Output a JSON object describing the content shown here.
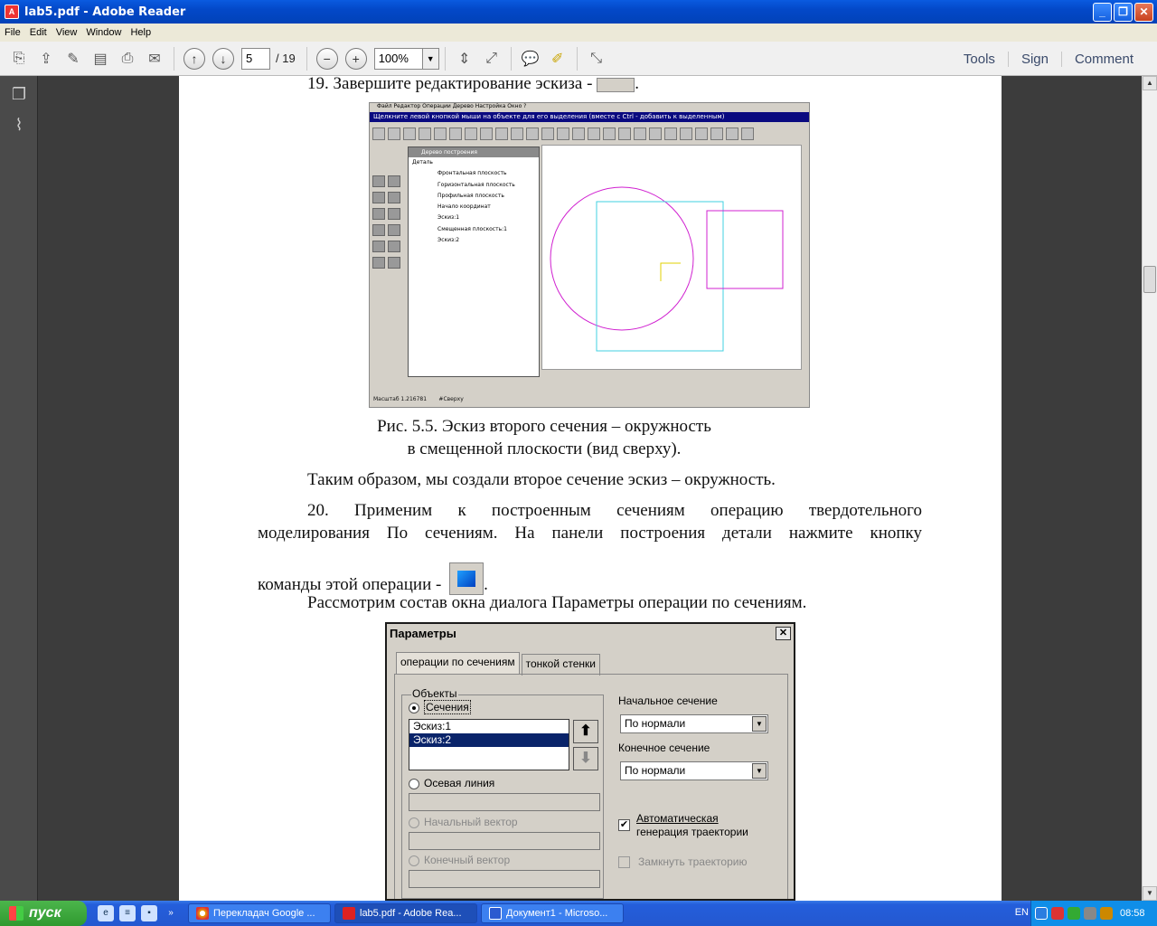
{
  "window": {
    "title": "lab5.pdf - Adobe Reader"
  },
  "menu": [
    "File",
    "Edit",
    "View",
    "Window",
    "Help"
  ],
  "toolbar": {
    "page_current": "5",
    "page_total": "/ 19",
    "zoom": "100%",
    "right_buttons": [
      "Tools",
      "Sign",
      "Comment"
    ]
  },
  "document": {
    "step19": "19. Завершите редактирование эскиза -",
    "step19_end": ".",
    "caption_line1": "Рис. 5.5. Эскиз второго сечения – окружность",
    "caption_line2": "в смещенной плоскости (вид сверху).",
    "para1": "Таким образом, мы создали второе сечение эскиз – окружность.",
    "step20_line1": "20. Применим к построенным сечениям операцию твердотельного",
    "step20_line2": "моделирования По сечениям. На панели построения детали нажмите кнопку",
    "step20_line3": "команды этой операции -",
    "step20_end": ".",
    "para2": "Рассмотрим состав окна диалога Параметры операции по сечениям."
  },
  "cad": {
    "menu": "Файл  Редактор  Операции  Дерево  Настройка  Окно  ?",
    "hint": "Щелкните левой кнопкой мыши на объекте для его выделения (вместе с Ctrl - добавить к выделенным)",
    "tree_title": "Дерево построения",
    "tree_items": [
      "Деталь",
      "Фронтальная плоскость",
      "Горизонтальная плоскость",
      "Профильная плоскость",
      "Начало координат",
      "Эскиз:1",
      "Смещенная плоскость:1",
      "Эскиз:2"
    ],
    "status_scale": "Масштаб 1.216781",
    "status_view": "#Сверху"
  },
  "dialog": {
    "title": "Параметры",
    "tabs": [
      "операции по сечениям",
      "тонкой стенки"
    ],
    "group_label": "Объекты",
    "radio_sections": "Сечения",
    "sections": [
      "Эскиз:1",
      "Эскиз:2"
    ],
    "radio_axis": "Осевая линия",
    "radio_start_vector": "Начальный вектор",
    "radio_end_vector": "Конечный вектор",
    "start_section_label": "Начальное сечение",
    "start_section_value": "По нормали",
    "end_section_label": "Конечное сечение",
    "end_section_value": "По нормали",
    "auto_traj": "Автоматическая",
    "auto_traj2": "генерация траектории",
    "close_traj": "Замкнуть траекторию"
  },
  "taskbar": {
    "start": "пуск",
    "tasks": [
      "Перекладач Google ...",
      "lab5.pdf - Adobe Rea...",
      "Документ1 - Microso..."
    ],
    "lang": "EN",
    "time": "08:58"
  }
}
